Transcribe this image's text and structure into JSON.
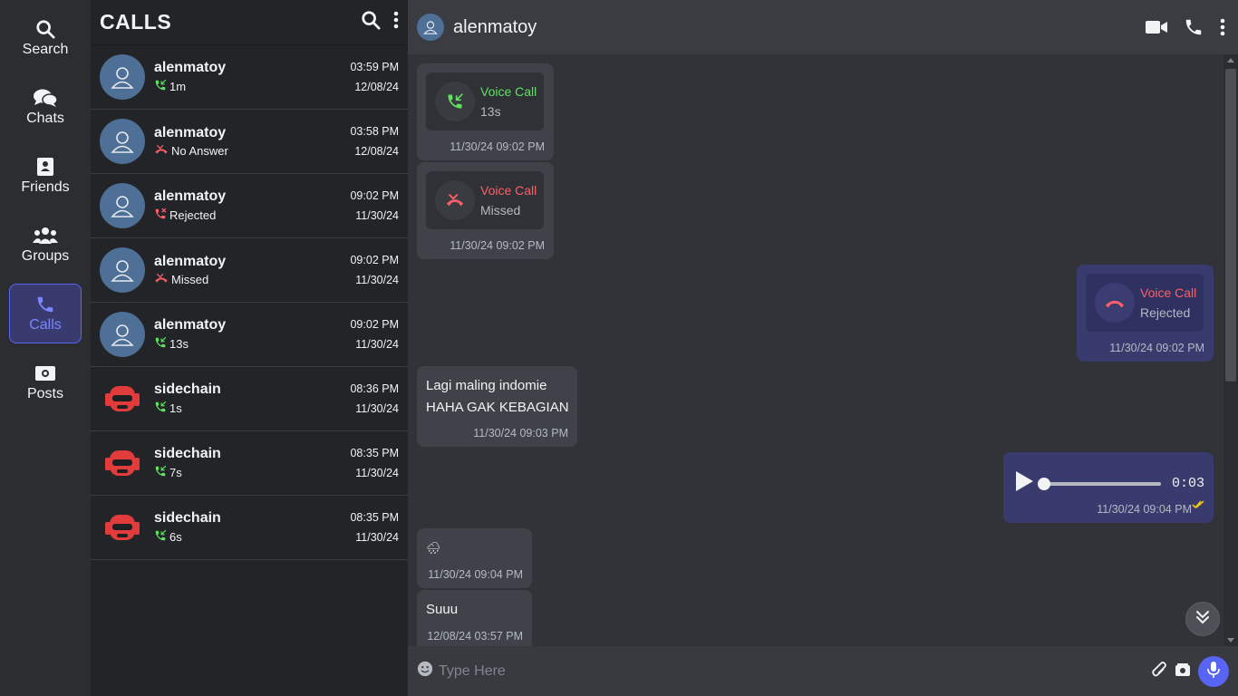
{
  "nav": {
    "items": [
      {
        "label": "Search",
        "icon": "search-icon"
      },
      {
        "label": "Chats",
        "icon": "chats-icon"
      },
      {
        "label": "Friends",
        "icon": "friends-icon"
      },
      {
        "label": "Groups",
        "icon": "groups-icon"
      },
      {
        "label": "Calls",
        "icon": "calls-icon",
        "active": true
      },
      {
        "label": "Posts",
        "icon": "posts-icon"
      }
    ]
  },
  "calls": {
    "title": "CALLS",
    "items": [
      {
        "name": "alenmatoy",
        "status": "1m",
        "status_type": "incoming",
        "time": "03:59 PM",
        "date": "12/08/24"
      },
      {
        "name": "alenmatoy",
        "status": "No Answer",
        "status_type": "missed",
        "time": "03:58 PM",
        "date": "12/08/24"
      },
      {
        "name": "alenmatoy",
        "status": "Rejected",
        "status_type": "rejected",
        "time": "09:02 PM",
        "date": "11/30/24"
      },
      {
        "name": "alenmatoy",
        "status": "Missed",
        "status_type": "missed",
        "time": "09:02 PM",
        "date": "11/30/24"
      },
      {
        "name": "alenmatoy",
        "status": "13s",
        "status_type": "incoming",
        "time": "09:02 PM",
        "date": "11/30/24"
      },
      {
        "name": "sidechain",
        "status": "1s",
        "status_type": "incoming",
        "time": "08:36 PM",
        "date": "11/30/24"
      },
      {
        "name": "sidechain",
        "status": "7s",
        "status_type": "incoming",
        "time": "08:35 PM",
        "date": "11/30/24"
      },
      {
        "name": "sidechain",
        "status": "6s",
        "status_type": "incoming",
        "time": "08:35 PM",
        "date": "11/30/24"
      }
    ]
  },
  "chat": {
    "contact": "alenmatoy",
    "messages": [
      {
        "type": "call",
        "label": "Voice Call",
        "sub": "13s",
        "time": "11/30/24 09:02 PM"
      },
      {
        "type": "call",
        "label": "Voice Call",
        "sub": "Missed",
        "time": "11/30/24 09:02 PM"
      },
      {
        "type": "call",
        "label": "Voice Call",
        "sub": "Rejected",
        "time": "11/30/24 09:02 PM"
      },
      {
        "type": "text",
        "line1": "Lagi maling indomie",
        "line2": "HAHA GAK KEBAGIAN",
        "time": "11/30/24 09:03 PM"
      },
      {
        "type": "audio",
        "duration": "0:03",
        "time": "11/30/24 09:04 PM"
      },
      {
        "type": "text",
        "line1": "🌧",
        "time": "11/30/24 09:04 PM"
      },
      {
        "type": "text",
        "line1": "Suuu",
        "time": "12/08/24 03:57 PM"
      }
    ],
    "composer_placeholder": "Type Here"
  },
  "colors": {
    "accent": "#5865f2",
    "green": "#5fe35f",
    "red": "#ff5f66"
  }
}
